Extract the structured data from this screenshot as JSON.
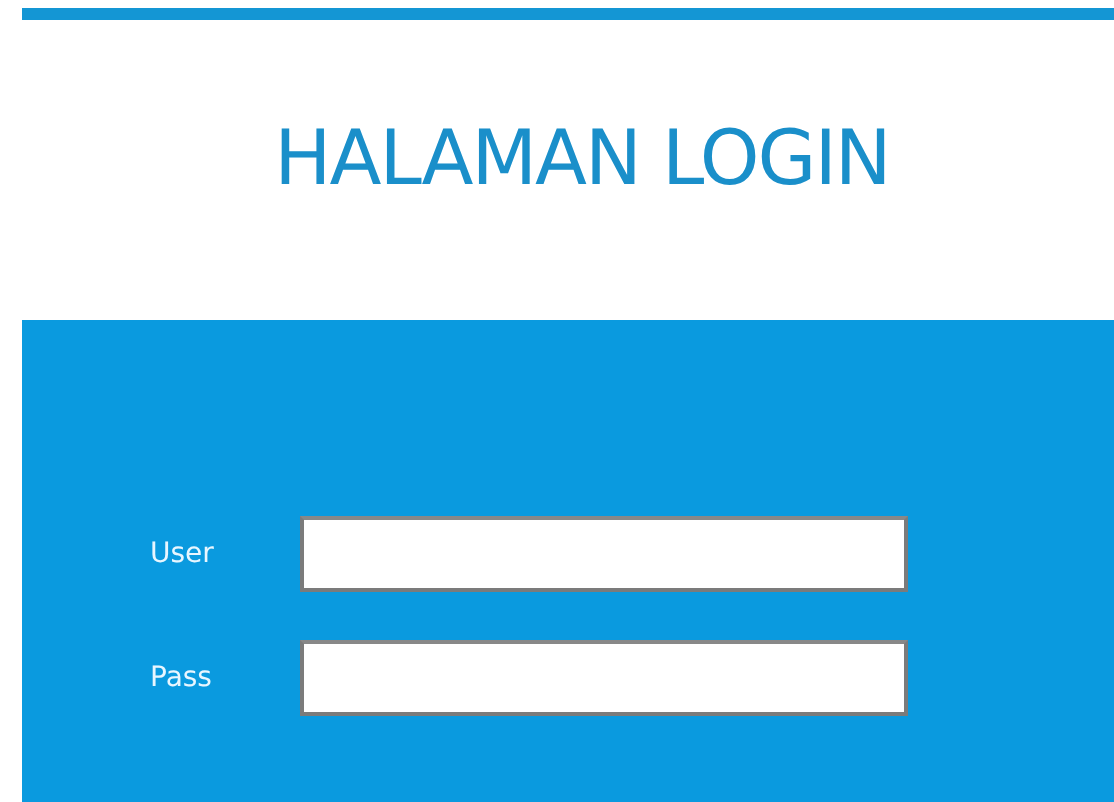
{
  "title": "HALAMAN LOGIN",
  "fields": [
    {
      "label": "User"
    },
    {
      "label": "Pass"
    }
  ]
}
